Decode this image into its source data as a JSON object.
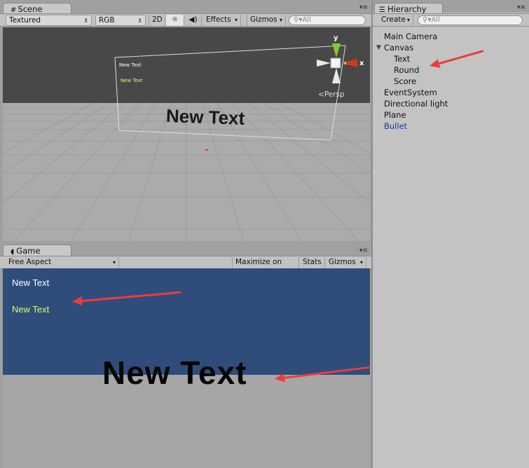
{
  "scene": {
    "tab_label": "Scene",
    "toolbar": {
      "render_mode": "Textured",
      "color_mode": "RGB",
      "mode_2d": "2D",
      "effects": "Effects",
      "gizmos": "Gizmos",
      "search_placeholder": "All"
    },
    "canvas_texts": {
      "text1": "New Text",
      "text2": "New Text",
      "big_text": "New Text"
    },
    "gizmo": {
      "y_label": "y",
      "x_label": "x",
      "persp_label": "Persp"
    }
  },
  "game": {
    "tab_label": "Game",
    "toolbar": {
      "aspect": "Free Aspect",
      "maximize": "Maximize on Play",
      "stats": "Stats",
      "gizmos": "Gizmos"
    },
    "texts": {
      "text1": "New Text",
      "text2": "New Text",
      "big_text": "New Text"
    }
  },
  "hierarchy": {
    "tab_label": "Hierarchy",
    "create_label": "Create",
    "search_placeholder": "All",
    "items": [
      "Main Camera",
      "Canvas",
      "Text",
      "Round",
      "Score",
      "EventSystem",
      "Directional light",
      "Plane",
      "Bullet"
    ]
  },
  "colors": {
    "game_bg": "#2f4d7a",
    "selected_item": "#1a3cb0",
    "annotation_arrow": "#ef3b3b",
    "yellow_text": "#d9ff5a"
  }
}
